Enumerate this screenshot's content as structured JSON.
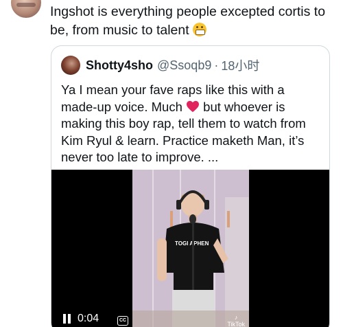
{
  "reply": {
    "text": "Ingshot is everything people excepted cortis to be, from music to talent",
    "emoji": "grimacing-face"
  },
  "quote": {
    "name": "Shotty4sho",
    "handle": "@Ssoqb9",
    "separator": "·",
    "time": "18小时",
    "text_part1": "Ya I mean your fave raps like this with a made-up voice. Much ",
    "heart_emoji": "red-heart",
    "text_part2": " but whoever is making this boy rap, tell them to watch from Kim Ryul & learn. Practice maketh Man, it’s never too late to improve.  ..."
  },
  "video": {
    "time": "0:04",
    "cc_label": "CC",
    "shirt_text": "TOGI APHEN",
    "watermark": "TikTok"
  },
  "colors": {
    "text_primary": "#0f1419",
    "text_secondary": "#536471",
    "border": "#cfd9de",
    "heart": "#e0245e"
  }
}
